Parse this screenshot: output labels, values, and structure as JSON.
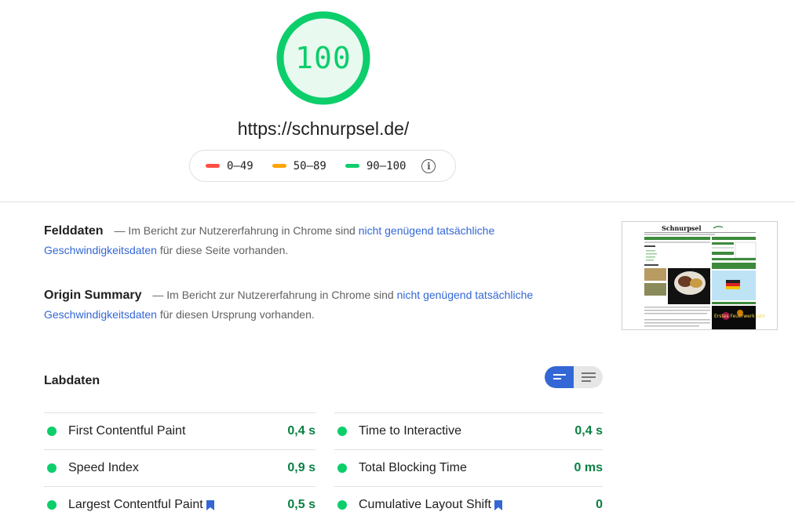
{
  "score": {
    "value": "100",
    "ring_color": "#0cce6b",
    "fill_color": "#e8faf0"
  },
  "url": "https://schnurpsel.de/",
  "legend": {
    "items": [
      {
        "label": "0–49",
        "color": "#ff4e42"
      },
      {
        "label": "50–89",
        "color": "#ffa400"
      },
      {
        "label": "90–100",
        "color": "#0cce6b"
      }
    ],
    "info_icon": "info-icon"
  },
  "field_data": {
    "title": "Felddaten",
    "dash": "—",
    "text_before": "Im Bericht zur Nutzererfahrung in Chrome sind",
    "link": "nicht genügend tatsächliche Geschwindigkeitsdaten",
    "text_after": "für diese Seite vorhanden."
  },
  "origin_summary": {
    "title": "Origin Summary",
    "dash": "—",
    "text_before": "Im Bericht zur Nutzererfahrung in Chrome sind",
    "link": "nicht genügend tatsächliche Geschwindigkeitsdaten",
    "text_after": "für diesen Ursprung vorhanden."
  },
  "thumbnail": {
    "site_name": "Schnurpsel",
    "banner_text": "Erstes Feuerwerk Jahr"
  },
  "lab_data": {
    "title": "Labdaten",
    "toggle": {
      "left_icon": "compact-view-icon",
      "right_icon": "list-view-icon",
      "active": "left"
    },
    "metrics": [
      {
        "name": "First Contentful Paint",
        "value": "0,4 s",
        "status": "pass",
        "bookmark": false
      },
      {
        "name": "Time to Interactive",
        "value": "0,4 s",
        "status": "pass",
        "bookmark": false
      },
      {
        "name": "Speed Index",
        "value": "0,9 s",
        "status": "pass",
        "bookmark": false
      },
      {
        "name": "Total Blocking Time",
        "value": "0 ms",
        "status": "pass",
        "bookmark": false
      },
      {
        "name": "Largest Contentful Paint",
        "value": "0,5 s",
        "status": "pass",
        "bookmark": true
      },
      {
        "name": "Cumulative Layout Shift",
        "value": "0",
        "status": "pass",
        "bookmark": true
      }
    ],
    "pass_color": "#0cce6b",
    "value_color": "#0a8043",
    "bookmark_color": "#3367d6"
  }
}
